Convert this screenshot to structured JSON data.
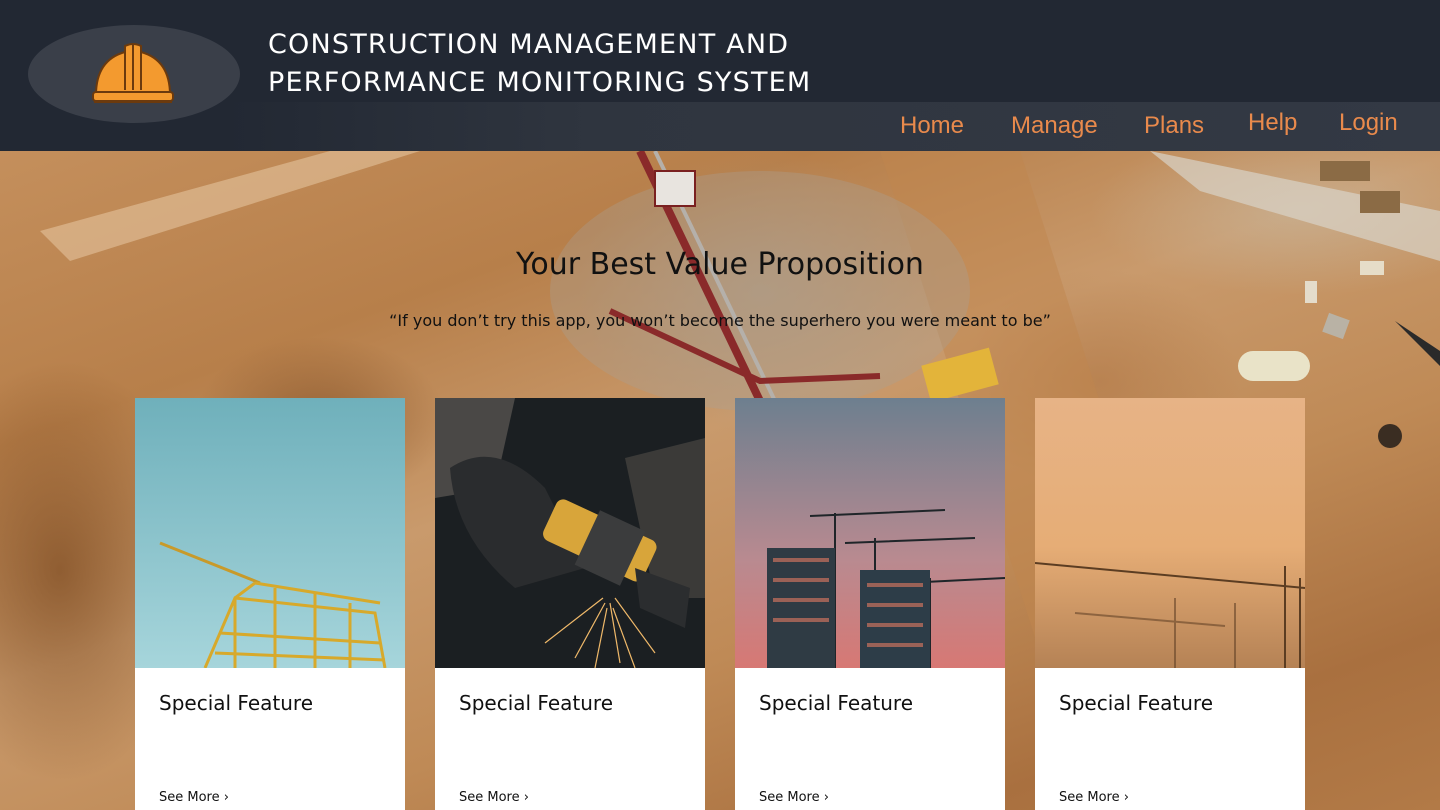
{
  "header": {
    "title_line1": "CONSTRUCTION MANAGEMENT AND",
    "title_line2": "PERFORMANCE MONITORING SYSTEM",
    "logo_icon": "hard-hat-icon"
  },
  "nav": {
    "items": [
      {
        "label": "Home"
      },
      {
        "label": "Manage"
      },
      {
        "label": "Plans"
      },
      {
        "label": "Help"
      },
      {
        "label": "Login"
      }
    ]
  },
  "hero": {
    "headline": "Your Best Value Proposition",
    "quote": "“If you don’t try this app, you won’t become the superhero you were meant to be”"
  },
  "cards": [
    {
      "title": "Special Feature",
      "link": "See More ›"
    },
    {
      "title": "Special Feature",
      "link": "See More ›"
    },
    {
      "title": "Special Feature",
      "link": "See More ›"
    },
    {
      "title": "Special Feature",
      "link": "See More ›"
    }
  ],
  "colors": {
    "header_bg": "#222833",
    "nav_text": "#e98a4c",
    "logo_orange": "#f39a2f"
  }
}
